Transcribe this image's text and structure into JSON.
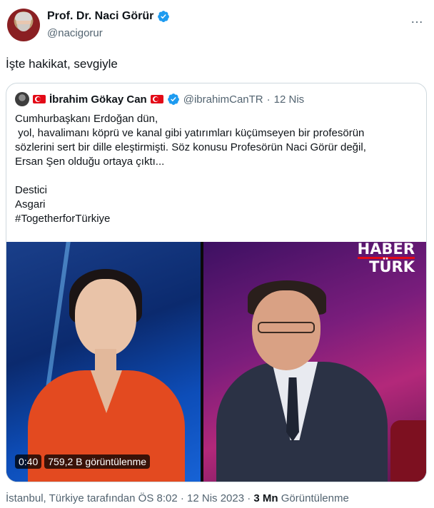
{
  "author": {
    "name": "Prof. Dr. Naci Görür",
    "handle": "@nacigorur",
    "more_icon": "…"
  },
  "tweet": {
    "text": "İşte hakikat, sevgiyle"
  },
  "quote": {
    "name": "İbrahim Gökay Can",
    "handle": "@ibrahimCanTR",
    "dot": "·",
    "date": "12 Nis",
    "lines": [
      "Cumhurbaşkanı Erdoğan dün,",
      " yol, havalimanı köprü ve kanal gibi yatırımları küçümseyen bir profesörün",
      "sözlerini sert bir dille eleştirmişti. Söz konusu Profesörün Naci Görür değil,",
      "Ersan Şen olduğu ortaya çıktı..."
    ],
    "tags": [
      "Destici",
      "Asgari",
      "#TogetherforTürkiye"
    ]
  },
  "video": {
    "logo_line1": "HABER",
    "logo_line2": "TÜRK",
    "time": "0:40",
    "views": "759,2 B görüntülenme"
  },
  "meta": {
    "location": "İstanbul, Türkiye tarafından ÖS 8:02 · 12 Nis 2023 · ",
    "views_count": "3 Mn",
    "views_label": " Görüntülenme"
  },
  "colors": {
    "verified": "#1d9bf0",
    "secondary_text": "#536471",
    "flag_red": "#e30a17"
  }
}
